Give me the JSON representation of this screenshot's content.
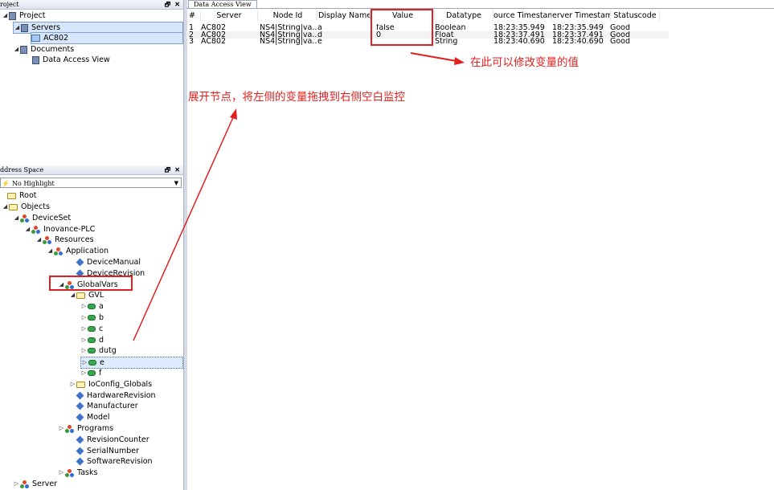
{
  "project_panel": {
    "title": "roject",
    "pin_icon": "pin-icon",
    "close_icon": "close-icon",
    "items": [
      "Project",
      "Servers",
      "AC802",
      "Documents",
      "Data Access View"
    ]
  },
  "address_panel": {
    "title": "ddress Space",
    "filter_value": "No Highlight",
    "items": [
      "Root",
      "Objects",
      "DeviceSet",
      "Inovance-PLC",
      "Resources",
      "Application",
      "DeviceManual",
      "DeviceRevision",
      "GlobalVars",
      "GVL",
      "a",
      "b",
      "c",
      "d",
      "dutg",
      "e",
      "f",
      "IoConfig_Globals",
      "HardwareRevision",
      "Manufacturer",
      "Model",
      "Programs",
      "RevisionCounter",
      "SerialNumber",
      "SoftwareRevision",
      "Tasks",
      "Server"
    ]
  },
  "data_view": {
    "tab_label": "Data Access View",
    "columns": [
      "#",
      "Server",
      "Node Id",
      "Display Name",
      "Value",
      "Datatype",
      "ource Timestam",
      "erver Timestam",
      "Statuscode"
    ],
    "rows": [
      [
        "1",
        "AC802",
        "NS4|String|va...",
        "a",
        "false",
        "Boolean",
        "18:23:35.949",
        "18:23:35.949",
        "Good"
      ],
      [
        "2",
        "AC802",
        "NS4|String|va...",
        "d",
        "0",
        "Float",
        "18:23:37.491",
        "18:23:37.491",
        "Good"
      ],
      [
        "3",
        "AC802",
        "NS4|String|va...",
        "e",
        "",
        "String",
        "18:23:40.690",
        "18:23:40.690",
        "Good"
      ]
    ]
  },
  "annotations": {
    "modify_value": "在此可以修改变量的值",
    "drag_hint": "展开节点，将左侧的变量拖拽到右侧空白监控"
  },
  "colors": {
    "annotation": "#e02020",
    "selection": "#d7e6fb"
  }
}
